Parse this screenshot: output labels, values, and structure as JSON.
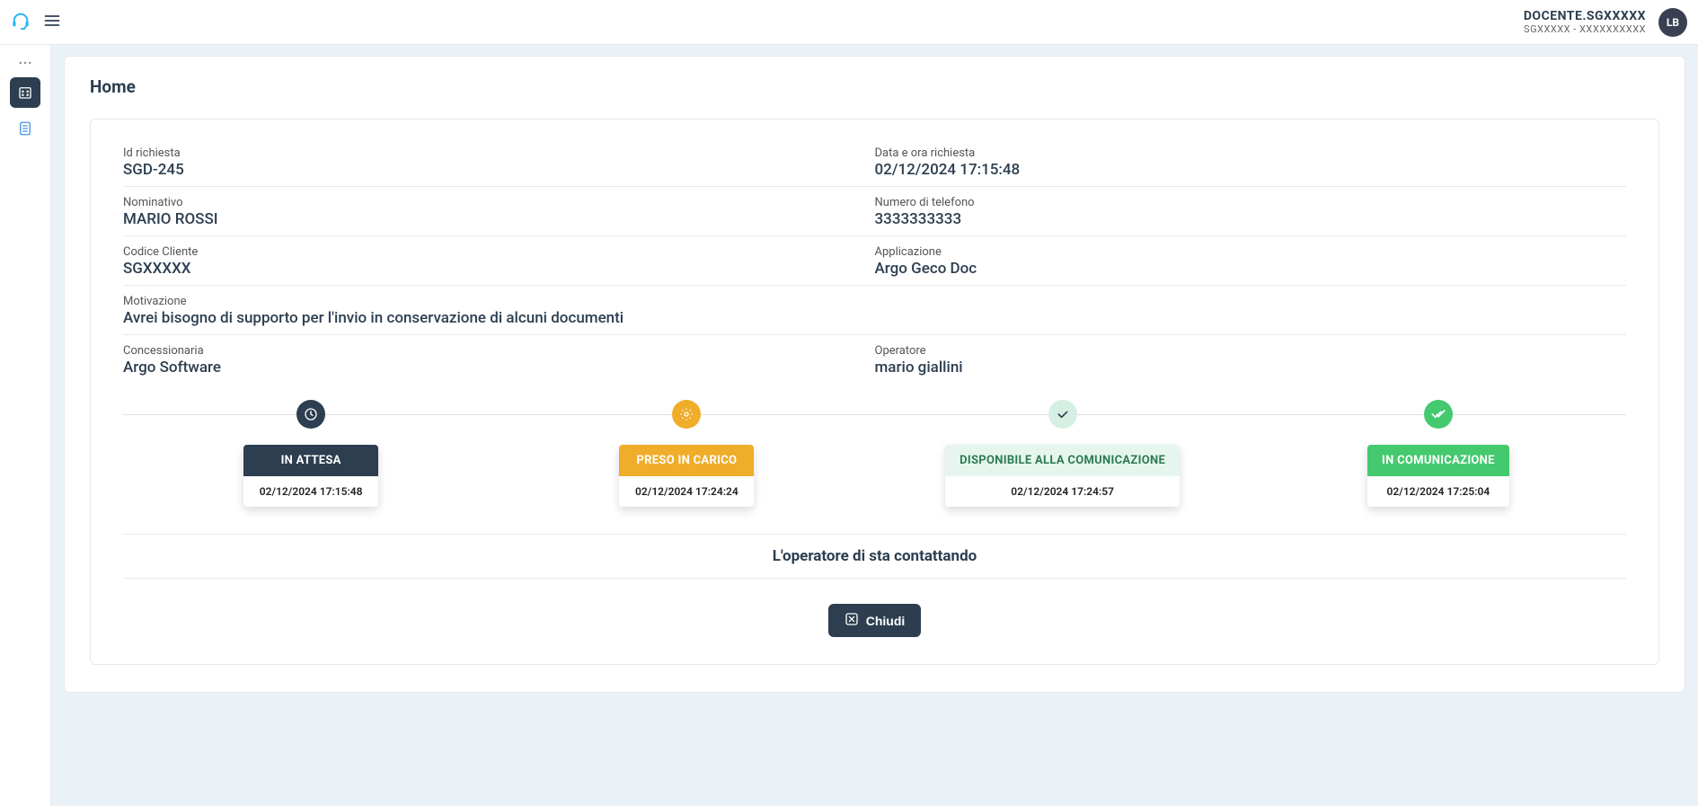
{
  "header": {
    "user_line1": "DOCENTE.SGXXXXX",
    "user_line2": "SGXXXXX - XXXXXXXXXX",
    "avatar_initials": "LB"
  },
  "page": {
    "title": "Home"
  },
  "request": {
    "id_label": "Id richiesta",
    "id_value": "SGD-245",
    "date_label": "Data e ora richiesta",
    "date_value": "02/12/2024 17:15:48",
    "name_label": "Nominativo",
    "name_value": "MARIO ROSSI",
    "phone_label": "Numero di telefono",
    "phone_value": "3333333333",
    "client_code_label": "Codice Cliente",
    "client_code_value": "SGXXXXX",
    "app_label": "Applicazione",
    "app_value": "Argo Geco Doc",
    "motivation_label": "Motivazione",
    "motivation_value": "Avrei bisogno di supporto per l'invio in conservazione di alcuni documenti",
    "dealer_label": "Concessionaria",
    "dealer_value": "Argo Software",
    "operator_label": "Operatore",
    "operator_value": "mario giallini"
  },
  "steps": [
    {
      "title": "IN ATTESA",
      "time": "02/12/2024 17:15:48"
    },
    {
      "title": "PRESO IN CARICO",
      "time": "02/12/2024 17:24:24"
    },
    {
      "title": "DISPONIBILE ALLA COMUNICAZIONE",
      "time": "02/12/2024 17:24:57"
    },
    {
      "title": "IN COMUNICAZIONE",
      "time": "02/12/2024 17:25:04"
    }
  ],
  "status_message": "L'operatore di sta contattando",
  "close_button_label": "Chiudi"
}
